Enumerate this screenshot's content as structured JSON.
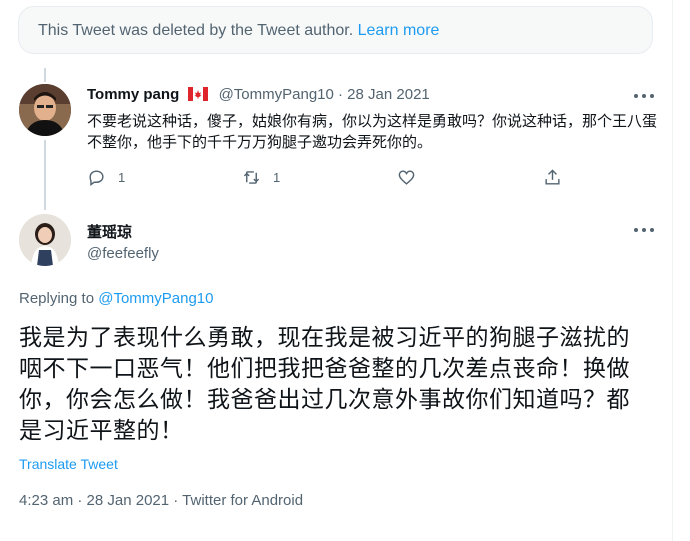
{
  "deleted_notice": {
    "text": "This Tweet was deleted by the Tweet author.",
    "link": "Learn more"
  },
  "reply_tweet": {
    "name": "Tommy pang",
    "flag_icon": "canada-flag-icon",
    "meta": "@TommyPang10 · 28 Jan 2021",
    "body": "不要老说这种话，傻子，姑娘你有病，你以为这样是勇敢吗？你说这种话，那个王八蛋不整你，他手下的千千万万狗腿子邀功会弄死你的。",
    "reply_count": "1",
    "retweet_count": "1",
    "colors": {
      "text": "#0f1419",
      "secondary": "#536471",
      "link": "#1d9bf0"
    }
  },
  "main_tweet": {
    "name": "董瑶琼",
    "handle": "@feefeefly",
    "replying_prefix": "Replying to",
    "replying_to": "@TommyPang10",
    "body": "我是为了表现什么勇敢，现在我是被习近平的狗腿子滋扰的咽不下一口恶气！他们把我把爸爸整的几次差点丧命！换做你，你会怎么做！我爸爸出过几次意外事故你们知道吗？都是习近平整的！",
    "translate": "Translate Tweet",
    "footer": "4:23 am · 28 Jan 2021 · Twitter for Android"
  }
}
